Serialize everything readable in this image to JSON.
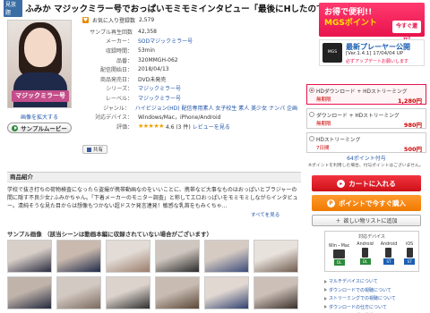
{
  "title": {
    "badge": "見放題",
    "text": "ふみか マジックミラー号でおっぱいモミモミインタビュー「最後にHしたのですか・・・おとといです・・」"
  },
  "cover": {
    "logo_text": "マジックミラー号",
    "zoom_link": "画像を拡大する",
    "movie_button": "サンプルムービー"
  },
  "favorite": {
    "label": "お気に入り登録数",
    "count": "2,579"
  },
  "info": [
    {
      "k": "サンプル再生回数",
      "v": "42,358",
      "link": false
    },
    {
      "k": "メーカー：",
      "v": "SODマジックミラー号",
      "link": true
    },
    {
      "k": "収録時間：",
      "v": "53min",
      "link": false
    },
    {
      "k": "品番：",
      "v": "320MMGH-062",
      "link": false
    },
    {
      "k": "配信開始日：",
      "v": "2018/04/13",
      "link": false
    },
    {
      "k": "商品発売日：",
      "v": "DVD未発売",
      "link": false
    },
    {
      "k": "シリーズ：",
      "v": "マジックミラー号",
      "link": true
    },
    {
      "k": "レーベル：",
      "v": "マジックミラー号",
      "link": true
    },
    {
      "k": "ジャンル：",
      "v": "ハイビジョン(HD) 配信専用素人 女子校生 素人 美少女 ナンパ 企画",
      "link": true
    },
    {
      "k": "対応デバイス：",
      "v": "Windows/Mac，iPhone/Android",
      "link": false
    }
  ],
  "rating": {
    "k": "評価：",
    "stars": "★★★★★",
    "score": "4.6 (3 件)",
    "review_link": "レビューを見る"
  },
  "share": {
    "label": "共有"
  },
  "description": {
    "heading": "商品紹介",
    "text": "学校で抜き打ちの荷物検査になったら盗撮が携帯動画なのをいいことに、携帯など大事なものはおっぱいとブラジャーの間に隠す不良少女♪ふみかちゃん。「下着メーカーのモニター調査」と称してエロおっぱいをモミモミしながらインタビュー。清純そうな見た目からは想像もつかない超ドスケ発言連発！敏感な乳首をもみくちゃ...",
    "more": "すべてを見る"
  },
  "samples": {
    "title": "サンプル画像 （該当シーンは動画本編に収録されていない場合がございます）",
    "count": 12
  },
  "banners": {
    "mgs_line1": "お得で便利!!",
    "mgs_line2": "MGSポイント",
    "mgs_button": "今すぐ還元!",
    "player_icon": "MGS Player",
    "player_title": "最新プレーヤー公開",
    "player_version": "[Ver.1.4.1] 17/04/04 UP",
    "player_note": "必ずアップデートお願いします"
  },
  "prices": [
    {
      "name": "HDダウンロード + HDストリーミング",
      "sub": "無期限",
      "price": "1,280円",
      "selected": true
    },
    {
      "name": "ダウンロード + HDストリーミング",
      "sub": "無期限",
      "price": "980円",
      "selected": false
    },
    {
      "name": "HDストリーミング",
      "sub": "7日間",
      "price": "500円",
      "selected": false
    }
  ],
  "point": {
    "label": "64ポイント付与",
    "note": "※ポイントを利用した場合、付与ポイントはございません。"
  },
  "buttons": {
    "cart": "カートに入れる",
    "buy": "ポイントで今すぐ購入",
    "wish": "欲しい物リストに追加"
  },
  "devices": {
    "heading": "対応デバイス",
    "items": [
      {
        "name": "Win・Mac",
        "tag": "DL"
      },
      {
        "name": "Android",
        "tag": "DL"
      },
      {
        "name": "Android",
        "tag": "ST"
      },
      {
        "name": "iOS",
        "tag": "ST"
      }
    ]
  },
  "links": [
    "マルチデバイスについて",
    "ダウンロードでの視聴について",
    "ストリーミングでの視聴について",
    "ダウンロードの仕方について",
    "ストリーミングの仕方について"
  ]
}
